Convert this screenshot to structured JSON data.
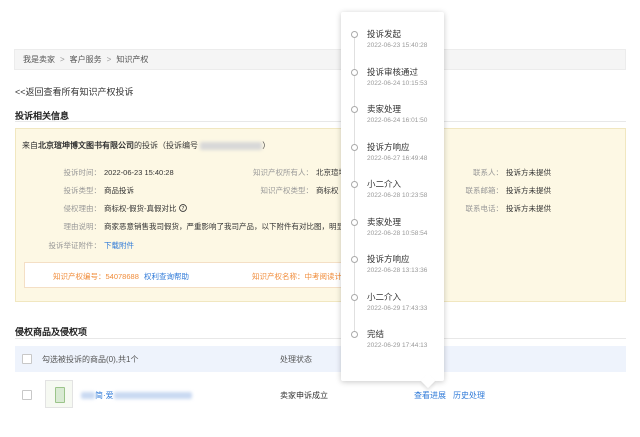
{
  "breadcrumb": [
    "我是卖家",
    "客户服务",
    "知识产权"
  ],
  "back_link": "<<返回查看所有知识产权投诉",
  "section1_title": "投诉相关信息",
  "from_line": {
    "prefix": "来自",
    "company": "北京瑄坤博文图书有限公司",
    "middle": "的投诉（投诉编号",
    "close_paren": "）"
  },
  "info_rows": [
    {
      "label": "投诉时间：",
      "value": "2022-06-23 15:40:28"
    },
    {
      "label": "投诉类型：",
      "value": "商品投诉"
    },
    {
      "label": "侵权理由：",
      "value": "商标权-假货-真假对比"
    },
    {
      "label": "理由说明：",
      "value": "商家恶意销售我司假货，严重影响了我司产品，以下附件有对比图，明显"
    },
    {
      "label": "投诉举证附件：",
      "value": "下载附件"
    }
  ],
  "middle_rows": [
    {
      "label": "知识产权所有人：",
      "value": "北京瑄坤博"
    },
    {
      "label": "知识产权类型：",
      "value": "商标权"
    }
  ],
  "right_rows": [
    {
      "label": "联系人：",
      "value": "投诉方未提供"
    },
    {
      "label": "联系邮箱：",
      "value": "投诉方未提供"
    },
    {
      "label": "联系电话：",
      "value": "投诉方未提供"
    }
  ],
  "ip_box": {
    "number_label": "知识产权编号：",
    "number_value": "54078688",
    "query_link": "权利查询帮助",
    "name_label": "知识产权名称：",
    "name_value": "中考阅读计"
  },
  "section2_title": "侵权商品及侵权项",
  "table": {
    "select_label": "勾选被投诉的商品(0),共1个",
    "status_header": "处理状态",
    "row": {
      "product_name": "简·爱",
      "status": "卖家申诉成立",
      "view_progress": "查看进展",
      "history": "历史处理"
    }
  },
  "timeline": [
    {
      "title": "投诉发起",
      "time": "2022-06-23 15:40:28"
    },
    {
      "title": "投诉审核通过",
      "time": "2022-06-24 10:15:53"
    },
    {
      "title": "卖家处理",
      "time": "2022-06-24 16:01:50"
    },
    {
      "title": "投诉方响应",
      "time": "2022-06-27 16:49:48"
    },
    {
      "title": "小二介入",
      "time": "2022-06-28 10:23:58"
    },
    {
      "title": "卖家处理",
      "time": "2022-06-28 10:58:54"
    },
    {
      "title": "投诉方响应",
      "time": "2022-06-28 13:13:36"
    },
    {
      "title": "小二介入",
      "time": "2022-06-29 17:43:33"
    },
    {
      "title": "完结",
      "time": "2022-06-29 17:44:13"
    }
  ],
  "icons": {
    "help_icon": "question-circle-icon",
    "product_thumb": "product-image"
  },
  "colors": {
    "link": "#2f7ad8",
    "orange": "#f08c3a",
    "info_bg": "#fdf8e4",
    "table_head_bg": "#eef3fc"
  }
}
